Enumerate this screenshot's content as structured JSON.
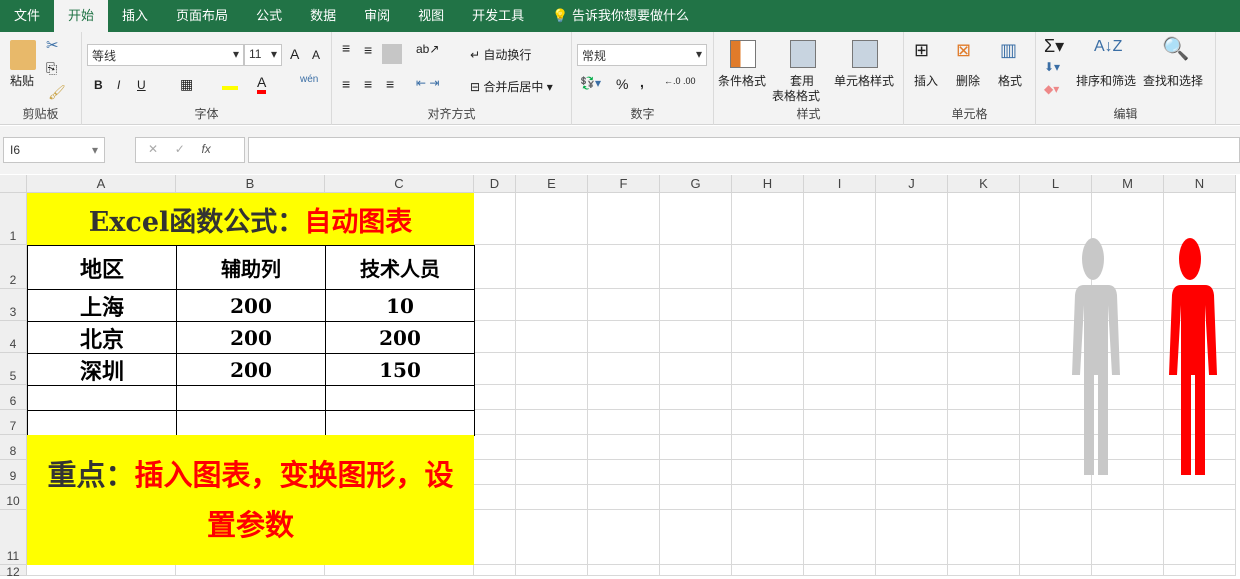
{
  "tabs": [
    "文件",
    "开始",
    "插入",
    "页面布局",
    "公式",
    "数据",
    "审阅",
    "视图",
    "开发工具"
  ],
  "tell_me": "告诉我你想要做什么",
  "ribbon": {
    "paste": "粘贴",
    "clipboard": "剪贴板",
    "font_name": "等线",
    "font_size": "11",
    "font_group": "字体",
    "wrap": "自动换行",
    "merge": "合并后居中",
    "align_group": "对齐方式",
    "number_format": "常规",
    "number_group": "数字",
    "cond_format": "条件格式",
    "table_format_1": "套用",
    "table_format_2": "表格格式",
    "cell_style": "单元格样式",
    "styles_group": "样式",
    "insert": "插入",
    "delete": "删除",
    "format": "格式",
    "cells_group": "单元格",
    "sort": "排序和筛选",
    "find": "查找和选择",
    "edit_group": "编辑",
    "bold": "B",
    "italic": "I",
    "underline": "U",
    "percent": "%",
    "comma": ","
  },
  "formula_bar": {
    "name_box": "I6",
    "fx": "fx",
    "value": ""
  },
  "columns": [
    "A",
    "B",
    "C",
    "D",
    "E",
    "F",
    "G",
    "H",
    "I",
    "J",
    "K",
    "L",
    "M",
    "N"
  ],
  "rows": [
    "1",
    "2",
    "3",
    "4",
    "5",
    "6",
    "7",
    "8",
    "9",
    "10",
    "11",
    "12"
  ],
  "sheet": {
    "title_black": "Excel函数公式：",
    "title_red": "自动图表",
    "headers": [
      "地区",
      "辅助列",
      "技术人员"
    ],
    "data": [
      [
        "上海",
        "200",
        "10"
      ],
      [
        "北京",
        "200",
        "200"
      ],
      [
        "深圳",
        "200",
        "150"
      ]
    ],
    "note_black": "重点：",
    "note_red": "插入图表，变换图形，设置参数"
  },
  "colors": {
    "green": "#217346",
    "yellow": "#ffff00",
    "red": "#ff0000",
    "gray": "#c8c8c8"
  }
}
